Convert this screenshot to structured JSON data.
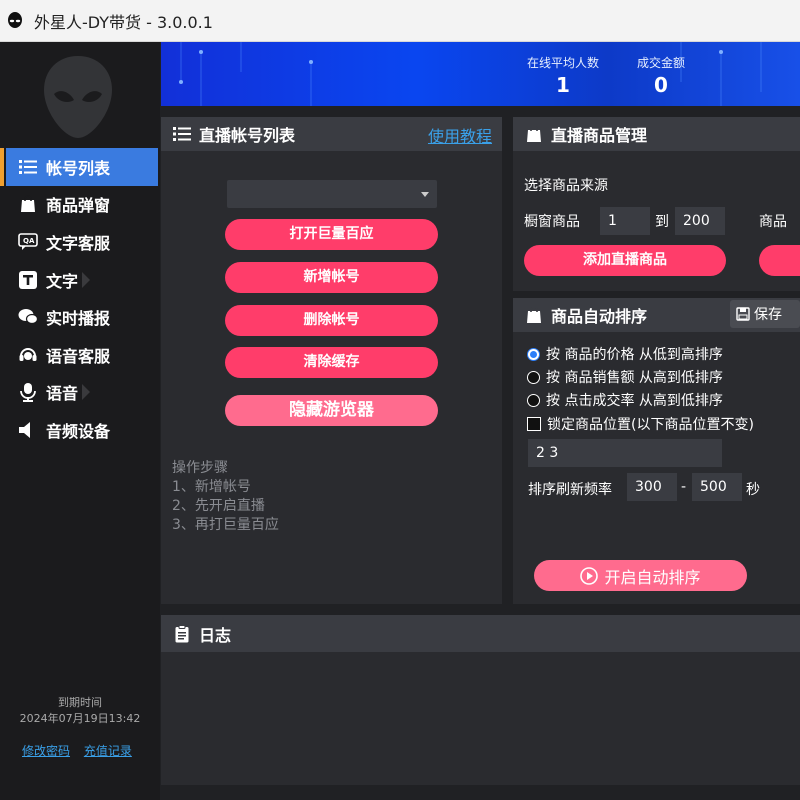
{
  "window": {
    "title": "外星人-DY带货 - 3.0.0.1"
  },
  "banner": {
    "online_label": "在线平均人数",
    "online_value": "1",
    "amount_label": "成交金额",
    "amount_value": "0"
  },
  "sidebar": {
    "items": [
      {
        "label": "帐号列表",
        "icon": "list-icon"
      },
      {
        "label": "商品弹窗",
        "icon": "bag-icon"
      },
      {
        "label": "文字客服",
        "icon": "qa-chat-icon"
      },
      {
        "label": "文字",
        "icon": "text-t-icon"
      },
      {
        "label": "实时播报",
        "icon": "chat-bubbles-icon"
      },
      {
        "label": "语音客服",
        "icon": "headset-icon"
      },
      {
        "label": "语音",
        "icon": "microphone-icon"
      },
      {
        "label": "音频设备",
        "icon": "speaker-icon"
      }
    ],
    "expire_label": "到期时间",
    "expire_date": "2024年07月19日13:42",
    "change_password": "修改密码",
    "recharge_log": "充值记录"
  },
  "accounts": {
    "title": "直播帐号列表",
    "tutorial": "使用教程",
    "buttons": {
      "open_baiying": "打开巨量百应",
      "add_account": "新增帐号",
      "delete_account": "删除帐号",
      "clear_cache": "清除缓存",
      "hide_browser": "隐藏游览器"
    },
    "steps": [
      "操作步骤",
      "1、新增帐号",
      "2、先开启直播",
      "3、再打巨量百应"
    ]
  },
  "products": {
    "title": "直播商品管理",
    "source_label": "选择商品来源",
    "showcase_label": "橱窗商品",
    "from_value": "1",
    "to_label": "到",
    "to_value": "200",
    "product_label": "商品",
    "add_button": "添加直播商品"
  },
  "sorting": {
    "title": "商品自动排序",
    "save": "保存",
    "options": [
      {
        "label": "按 商品的价格 从低到高排序",
        "selected": true
      },
      {
        "label": "按 商品销售额 从高到低排序",
        "selected": false
      },
      {
        "label": "按 点击成交率 从高到低排序",
        "selected": false
      }
    ],
    "lock_label": "锁定商品位置(以下商品位置不变)",
    "lock_value": "2 3",
    "refresh_label": "排序刷新频率",
    "refresh_min": "300",
    "dash": "-",
    "refresh_max": "500",
    "unit": "秒",
    "start_button": "开启自动排序"
  },
  "log": {
    "title": "日志"
  },
  "colors": {
    "accent": "#ff3d6a",
    "accent_light": "#ff6b8e",
    "active_nav": "#3a7be0",
    "link": "#3aa0e8"
  }
}
